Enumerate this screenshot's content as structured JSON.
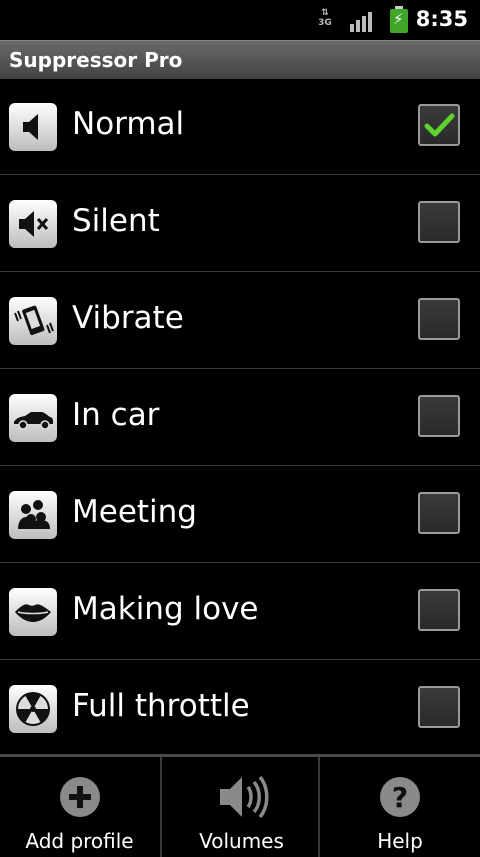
{
  "status": {
    "network": "3G",
    "time": "8:35"
  },
  "app": {
    "title": "Suppressor Pro"
  },
  "profiles": [
    {
      "label": "Normal",
      "icon": "speaker-icon",
      "checked": true
    },
    {
      "label": "Silent",
      "icon": "speaker-muted-icon",
      "checked": false
    },
    {
      "label": "Vibrate",
      "icon": "vibrate-phone-icon",
      "checked": false
    },
    {
      "label": "In car",
      "icon": "car-icon",
      "checked": false
    },
    {
      "label": "Meeting",
      "icon": "people-icon",
      "checked": false
    },
    {
      "label": "Making love",
      "icon": "lips-icon",
      "checked": false
    },
    {
      "label": "Full throttle",
      "icon": "radiation-icon",
      "checked": false
    }
  ],
  "toolbar": {
    "add_label": "Add profile",
    "volumes_label": "Volumes",
    "help_label": "Help"
  },
  "colors": {
    "check": "#5fd12e",
    "title_bar": "#555555"
  }
}
